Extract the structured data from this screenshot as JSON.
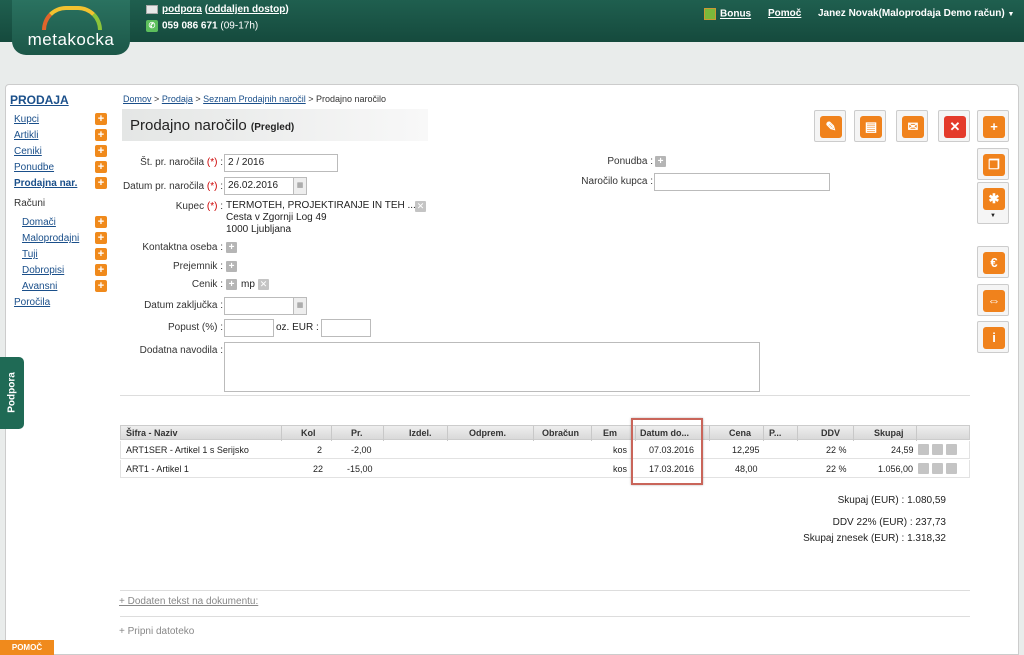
{
  "header": {
    "logo_text": "metakocka",
    "support_link": "podpora",
    "remote_access": "oddaljen dostop",
    "phone": "059 086 671",
    "hours": "(09-17h)",
    "bonus": "Bonus",
    "help": "Pomoč",
    "user": "Janez Novak(Maloprodaja Demo račun)"
  },
  "sidebar": {
    "title": "PRODAJA",
    "items": [
      "Kupci",
      "Artikli",
      "Ceniki",
      "Ponudbe",
      "Prodajna nar."
    ],
    "racuni_label": "Računi",
    "racuni_items": [
      "Domači",
      "Maloprodajni",
      "Tuji",
      "Dobropisi",
      "Avansni"
    ],
    "reports": "Poročila"
  },
  "side_tabs": {
    "podpora": "Podpora",
    "pomoc": "POMOČ"
  },
  "breadcrumb": {
    "home": "Domov",
    "sales": "Prodaja",
    "list": "Seznam Prodajnih naročil",
    "current": "Prodajno naročilo",
    "sep": ">"
  },
  "page": {
    "title": "Prodajno naročilo",
    "mode": "(Pregled)"
  },
  "form": {
    "order_no_label": "Št. pr. naročila",
    "order_no": "2 / 2016",
    "order_date_label": "Datum pr. naročila",
    "order_date": "26.02.2016",
    "req": "(*)",
    "customer_label": "Kupec",
    "customer_name": "TERMOTEH, PROJEKTIRANJE IN TEH ...",
    "customer_street": "Cesta v Zgornji Log 49",
    "customer_city": "1000 Ljubljana",
    "contact_label": "Kontaktna oseba",
    "receiver_label": "Prejemnik",
    "price_list_label": "Cenik",
    "price_list_value": "mp",
    "close_date_label": "Datum zaključka",
    "discount_label": "Popust (%)",
    "discount_eur_label": "oz. EUR",
    "notes_label": "Dodatna navodila",
    "offer_label": "Ponudba",
    "customer_order_label": "Naročilo kupca",
    "colon": ":"
  },
  "table": {
    "headers": [
      "Šifra - Naziv",
      "Kol",
      "Pr.",
      "Izdel.",
      "Odprem.",
      "Obračun",
      "Em",
      "Datum do...",
      "Cena",
      "P...",
      "DDV",
      "Skupaj"
    ],
    "rows": [
      {
        "name": "ART1SER - Artikel 1 s Serijsko",
        "kol": "2",
        "pr": "-2,00",
        "em": "kos",
        "date": "07.03.2016",
        "cena": "12,295",
        "ddv": "22 %",
        "skupaj": "24,59"
      },
      {
        "name": "ART1 - Artikel 1",
        "kol": "22",
        "pr": "-15,00",
        "em": "kos",
        "date": "17.03.2016",
        "cena": "48,00",
        "ddv": "22 %",
        "skupaj": "1.056,00"
      }
    ]
  },
  "totals": {
    "sum_label": "Skupaj (EUR) :",
    "sum": "1.080,59",
    "vat_label": "DDV 22% (EUR) :",
    "vat": "237,73",
    "total_label": "Skupaj znesek (EUR) :",
    "total": "1.318,32"
  },
  "footer_links": {
    "added_text": "+ Dodaten tekst na dokumentu:",
    "attach": "+ Pripni datoteko"
  },
  "colors": {
    "brand_green": "#1f5f4f",
    "accent_orange": "#f0821c",
    "link": "#1a4f8a"
  }
}
